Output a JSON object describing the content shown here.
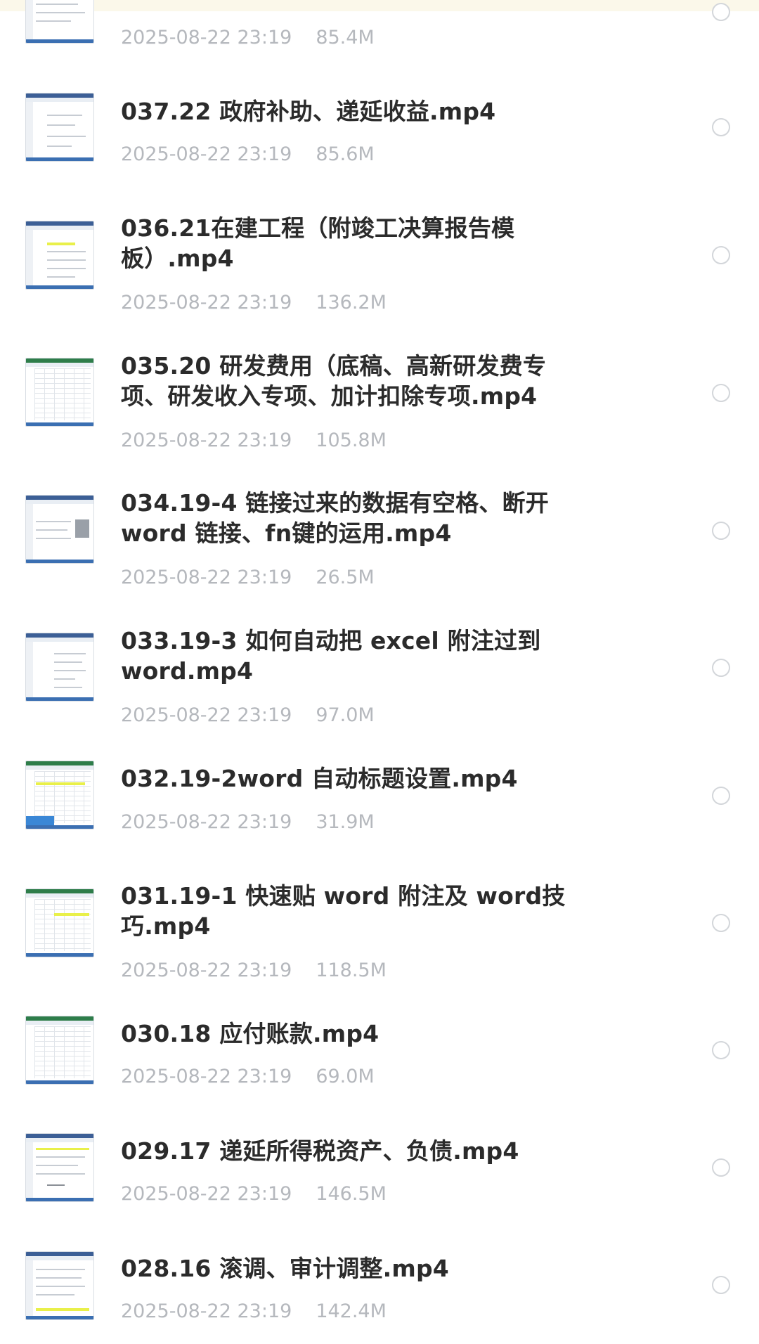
{
  "files": [
    {
      "name": "",
      "date": "2025-08-22 23:19",
      "size": "85.4M",
      "thumb": "word-doc",
      "selected": false
    },
    {
      "name": "037.22 政府补助、递延收益.mp4",
      "date": "2025-08-22 23:19",
      "size": "85.6M",
      "thumb": "word-doc",
      "selected": false
    },
    {
      "name": "036.21在建工程（附竣工决算报告模板）.mp4",
      "date": "2025-08-22 23:19",
      "size": "136.2M",
      "thumb": "word-doc",
      "selected": false
    },
    {
      "name": "035.20 研发费用（底稿、高新研发费专项、研发收入专项、加计扣除专项.mp4",
      "date": "2025-08-22 23:19",
      "size": "105.8M",
      "thumb": "excel-sheet",
      "selected": false
    },
    {
      "name": "034.19-4 链接过来的数据有空格、断开word 链接、fn键的运用.mp4",
      "date": "2025-08-22 23:19",
      "size": "26.5M",
      "thumb": "word-doc",
      "selected": false
    },
    {
      "name": "033.19-3 如何自动把 excel 附注过到word.mp4",
      "date": "2025-08-22 23:19",
      "size": "97.0M",
      "thumb": "word-doc",
      "selected": false
    },
    {
      "name": "032.19-2word 自动标题设置.mp4",
      "date": "2025-08-22 23:19",
      "size": "31.9M",
      "thumb": "excel-sheet",
      "selected": false
    },
    {
      "name": "031.19-1 快速贴 word 附注及 word技巧.mp4",
      "date": "2025-08-22 23:19",
      "size": "118.5M",
      "thumb": "excel-sheet",
      "selected": false
    },
    {
      "name": "030.18 应付账款.mp4",
      "date": "2025-08-22 23:19",
      "size": "69.0M",
      "thumb": "excel-sheet",
      "selected": false
    },
    {
      "name": "029.17 递延所得税资产、负债.mp4",
      "date": "2025-08-22 23:19",
      "size": "146.5M",
      "thumb": "word-doc",
      "selected": false
    },
    {
      "name": "028.16 滚调、审计调整.mp4",
      "date": "2025-08-22 23:19",
      "size": "142.4M",
      "thumb": "word-doc",
      "selected": false
    }
  ]
}
